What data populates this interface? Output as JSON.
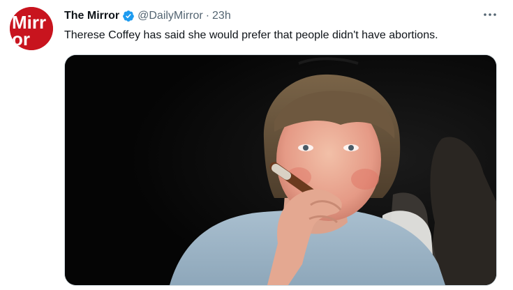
{
  "author": {
    "display_name": "The Mirror",
    "handle": "@DailyMirror",
    "separator": "·",
    "time": "23h",
    "logo_text": "Mirror",
    "logo_color": "#c8141e",
    "verified_color": "#1d9bf0"
  },
  "tweet": {
    "text": "Therese Coffey has said she would prefer that people didn't have abortions."
  },
  "media": {
    "icon": "photo"
  },
  "icons": {
    "verified": "verified-badge-icon",
    "more": "more-horizontal-icon"
  }
}
